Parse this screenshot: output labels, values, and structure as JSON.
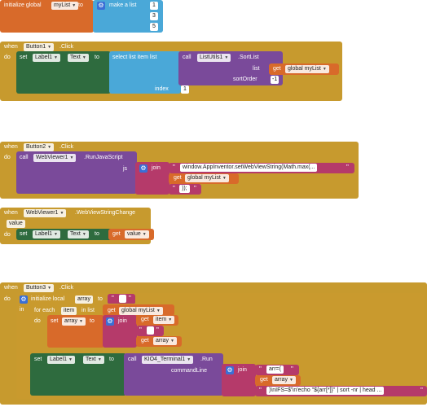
{
  "block1": {
    "initialize_global": "initialize global",
    "var_name": "myList",
    "to": "to",
    "make_a_list": "make a list",
    "items": [
      "1",
      "3",
      "5"
    ]
  },
  "block2": {
    "when": "when",
    "component": "Button1",
    "event": ".Click",
    "do": "do",
    "set": "set",
    "label_component": "Label1",
    "property": "Text",
    "to": "to",
    "select_list_item_list": "select list item  list",
    "call": "call",
    "list_utils": "ListUtils1",
    "method": ".SortList",
    "list_label": "list",
    "get": "get",
    "global_mylist": "global myList",
    "sort_order": "sortOrder",
    "sort_value": "-1",
    "index_label": "index",
    "index_value": "1"
  },
  "block3": {
    "when": "when",
    "component": "Button2",
    "event": ".Click",
    "do": "do",
    "call": "call",
    "webviewer": "WebViewer1",
    "method": ".RunJavaScript",
    "js_label": "js",
    "join": "join",
    "js_text": "window.AppInventor.setWebViewString(Math.max(...",
    "get": "get",
    "global_mylist": "global myList",
    "close_text": "));"
  },
  "block4": {
    "when": "when",
    "component": "WebViewer1",
    "event": ".WebViewStringChange",
    "param": "value",
    "do": "do",
    "set": "set",
    "label_component": "Label1",
    "property": "Text",
    "to": "to",
    "get": "get",
    "get_value": "value"
  },
  "block5": {
    "when": "when",
    "component": "Button3",
    "event": ".Click",
    "do": "do",
    "initialize_local": "initialize local",
    "local_name": "array",
    "to": "to",
    "in": "in",
    "for_each": "for each",
    "item_name": "item",
    "in_list": "in list",
    "get": "get",
    "global_mylist": "global myList",
    "set": "set",
    "array_var": "array",
    "join": "join",
    "get_item": "item",
    "get_array": "array",
    "label_component": "Label1",
    "property": "Text",
    "call": "call",
    "terminal": "KIO4_Terminal1",
    "run": ".Run",
    "command_line": "commandLine",
    "arr_text": "arr=(",
    "tail_text": ")\\nIFS=$'\\n'echo \"${arr[*]}\" | sort -nr | head ..."
  }
}
